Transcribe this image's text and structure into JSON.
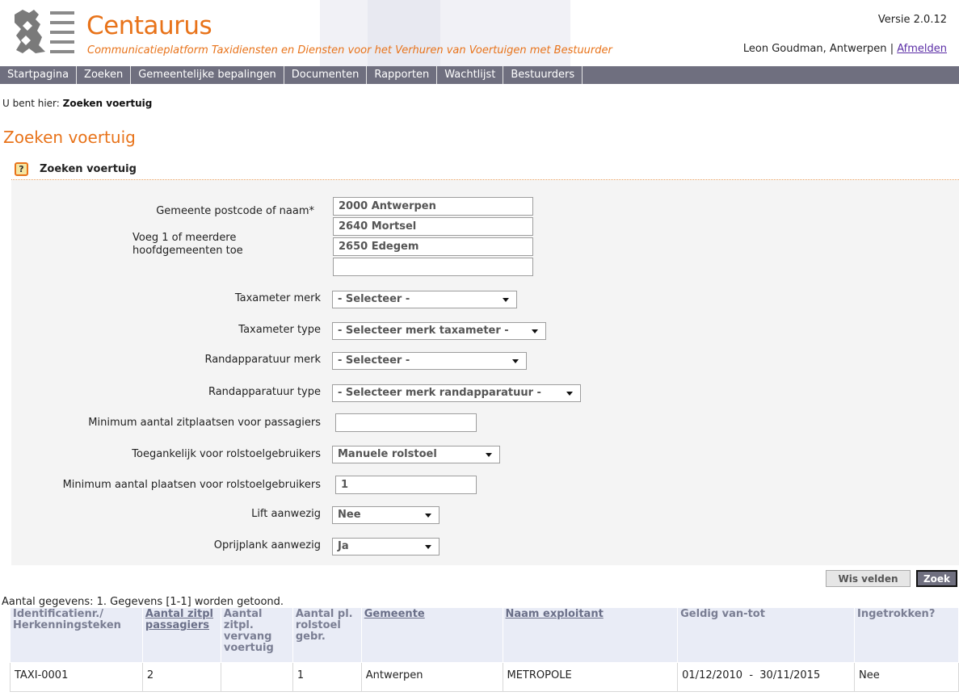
{
  "header": {
    "app_title": "Centaurus",
    "app_subtitle": "Communicatieplatform Taxidiensten en Diensten voor  het Verhuren van Voertuigen met Bestuurder",
    "version": "Versie 2.0.12",
    "user": "Leon Goudman, Antwerpen",
    "separator": "|",
    "logout_label": "Afmelden",
    "logo_icon": "flemish-lion-logo-icon",
    "brand_color": "#e8731a"
  },
  "nav": {
    "items": [
      "Startpagina",
      "Zoeken",
      "Gemeentelijke bepalingen",
      "Documenten",
      "Rapporten",
      "Wachtlijst",
      "Bestuurders"
    ]
  },
  "breadcrumb": {
    "prefix": "U bent hier:",
    "current": "Zoeken voertuig"
  },
  "page_title": "Zoeken voertuig",
  "section": {
    "help_label": "?",
    "title": "Zoeken voertuig"
  },
  "form": {
    "gemeente_label": "Gemeente postcode of naam*",
    "gemeente_hint": "Voeg 1 of meerdere hoofdgemeenten toe",
    "gemeenten": [
      "2000 Antwerpen",
      "2640 Mortsel",
      "2650 Edegem",
      ""
    ],
    "taxameter_merk_label": "Taxameter merk",
    "taxameter_merk_value": "- Selecteer -",
    "taxameter_type_label": "Taxameter type",
    "taxameter_type_value": "- Selecteer merk taxameter -",
    "rand_merk_label": "Randapparatuur merk",
    "rand_merk_value": "- Selecteer -",
    "rand_type_label": "Randapparatuur type",
    "rand_type_value": "- Selecteer merk randapparatuur -",
    "min_zit_label": "Minimum aantal zitplaatsen voor passagiers",
    "min_zit_value": "",
    "rolstoel_label": "Toegankelijk voor rolstoelgebruikers",
    "rolstoel_value": "Manuele rolstoel",
    "min_rol_label": "Minimum aantal plaatsen voor rolstoelgebruikers",
    "min_rol_value": "1",
    "lift_label": "Lift aanwezig",
    "lift_value": "Nee",
    "oprij_label": "Oprijplank aanwezig",
    "oprij_value": "Ja"
  },
  "buttons": {
    "clear": "Wis velden",
    "search": "Zoek"
  },
  "results": {
    "count_text": "Aantal gegevens: 1. Gegevens [1-1] worden getoond.",
    "columns": [
      "Identificatienr./ Herkenningsteken",
      "Aantal zitpl passagiers",
      "Aantal zitpl. vervang voertuig",
      "Aantal pl. rolstoel gebr.",
      "Gemeente",
      "Naam exploitant",
      "Geldig van-tot",
      "Ingetrokken?"
    ],
    "rows": [
      [
        "TAXI-0001",
        "2",
        "",
        "1",
        "Antwerpen",
        "METROPOLE",
        "01/12/2010  -  30/11/2015",
        "Nee"
      ]
    ]
  }
}
